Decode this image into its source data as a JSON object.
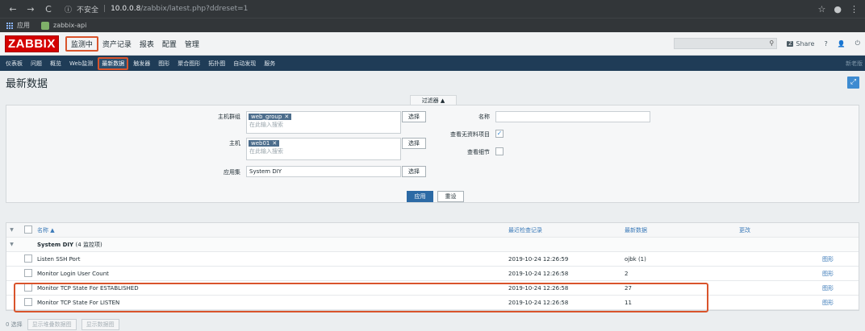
{
  "browser": {
    "insecure_label": "不安全",
    "url_host": "10.0.0.8",
    "url_path": "/zabbix/latest.php?ddreset=1",
    "bookmarks": [
      {
        "label": "应用"
      },
      {
        "label": "zabbix-api"
      }
    ]
  },
  "header": {
    "logo": "ZABBIX",
    "menu": [
      "监测中",
      "资产记录",
      "报表",
      "配置",
      "管理"
    ],
    "active_menu": "监测中",
    "share_label": "Share",
    "help": "?"
  },
  "submenu": {
    "items": [
      "仪表板",
      "问题",
      "概览",
      "Web监测",
      "最新数据",
      "触发器",
      "图形",
      "聚合图形",
      "拓扑图",
      "自动发现",
      "服务"
    ],
    "active": "最新数据",
    "right": "新老版"
  },
  "page": {
    "title": "最新数据"
  },
  "filter": {
    "tab_label": "过滤器 ▲",
    "host_group_label": "主机群组",
    "host_group_tag": "web_group",
    "host_group_placeholder": "在此输入搜索",
    "host_label": "主机",
    "host_tag": "web01",
    "host_placeholder": "在此输入搜索",
    "app_label": "应用集",
    "app_value": "System DIY",
    "select_label": "选择",
    "name_label": "名称",
    "name_value": "",
    "show_no_data_label": "查看无资料项目",
    "show_no_data_checked": true,
    "show_details_label": "查看细节",
    "show_details_checked": false,
    "apply_label": "应用",
    "reset_label": "重设"
  },
  "table": {
    "headers": {
      "name": "名称 ▲",
      "last_check": "最近检查记录",
      "last_value": "最新数据",
      "change": "更改"
    },
    "group": {
      "name": "System DIY",
      "count": "(4 监控项)"
    },
    "rows": [
      {
        "name": "Listen SSH Port",
        "time": "2019-10-24 12:26:59",
        "value": "ojbk (1)",
        "graph": "图形"
      },
      {
        "name": "Monitor Login User Count",
        "time": "2019-10-24 12:26:58",
        "value": "2",
        "graph": "图形"
      },
      {
        "name": "Monitor TCP State For ESTABLISHED",
        "time": "2019-10-24 12:26:58",
        "value": "27",
        "graph": "图形"
      },
      {
        "name": "Monitor TCP State For LISTEN",
        "time": "2019-10-24 12:26:58",
        "value": "11",
        "graph": "图形"
      }
    ]
  },
  "footer": {
    "selected": "0 选择",
    "btn1": "显示堆叠数据图",
    "btn2": "显示数据图"
  },
  "colors": {
    "logo_red": "#d40000",
    "nav_blue": "#1f3c57",
    "highlight": "#d9542c",
    "apply_blue": "#2c6aa5"
  }
}
